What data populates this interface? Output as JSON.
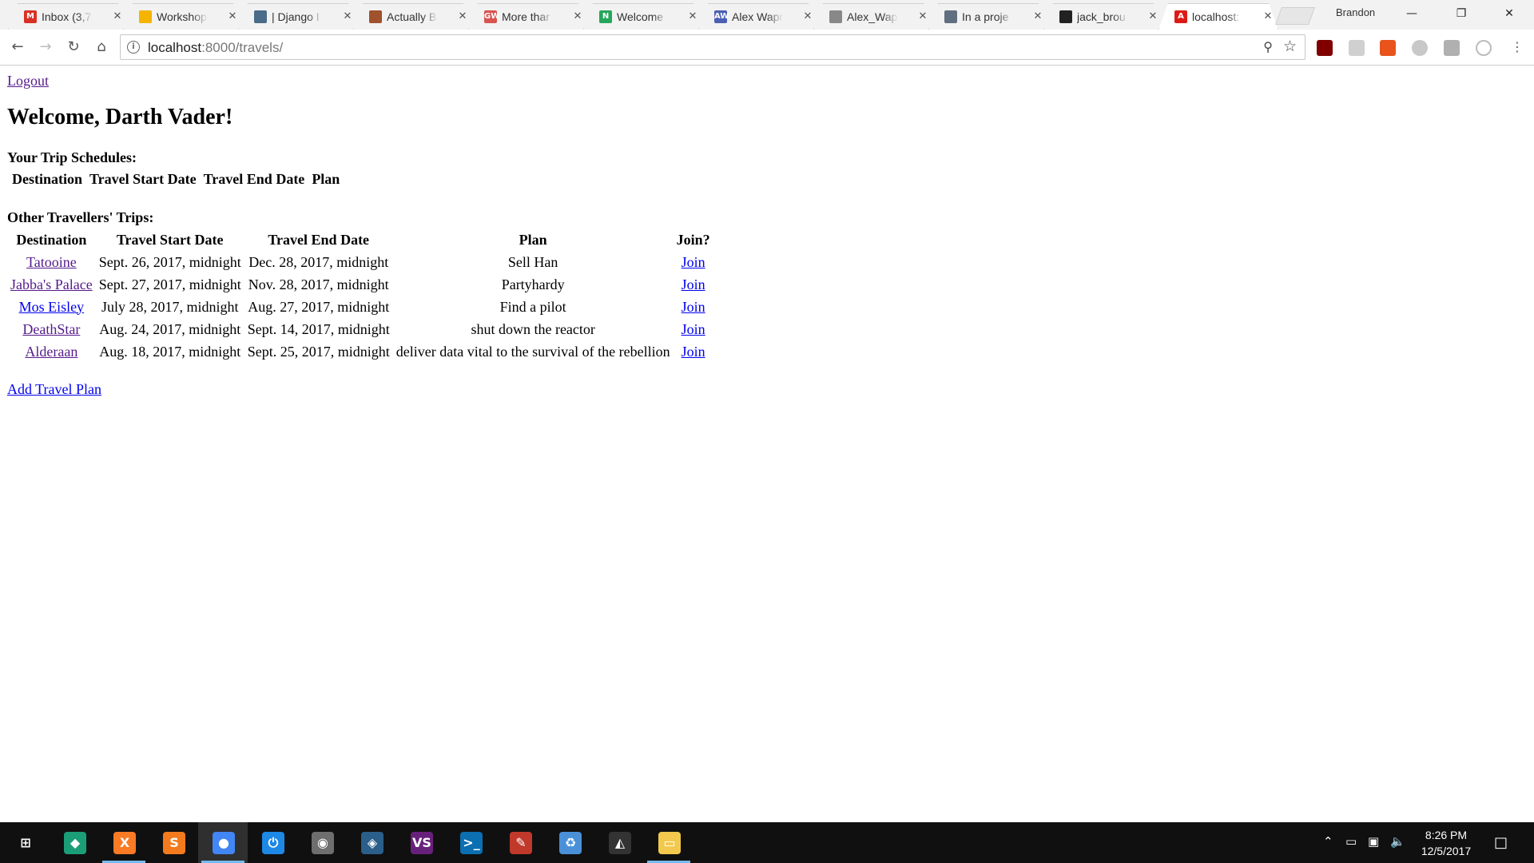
{
  "browser": {
    "tabs": [
      {
        "title": "Inbox (3,7",
        "favicon": "M",
        "color": "#d93025"
      },
      {
        "title": "Workshop",
        "favicon": "",
        "color": "#f4b400"
      },
      {
        "title": "| Django I",
        "favicon": "",
        "color": "#4a6b8a"
      },
      {
        "title": "Actually B",
        "favicon": "",
        "color": "#a0522d"
      },
      {
        "title": "More thar",
        "favicon": "GW",
        "color": "#d9534f"
      },
      {
        "title": "Welcome",
        "favicon": "N",
        "color": "#26a65b"
      },
      {
        "title": "Alex Wapr",
        "favicon": "AW",
        "color": "#4b5fb4"
      },
      {
        "title": "Alex_Wap",
        "favicon": "",
        "color": "#888888"
      },
      {
        "title": "In a proje",
        "favicon": "",
        "color": "#5f6f80"
      },
      {
        "title": "jack_brou",
        "favicon": "",
        "color": "#222222"
      },
      {
        "title": "localhost:",
        "favicon": "A",
        "color": "#dd1b16"
      }
    ],
    "active_tab": 10,
    "profile_name": "Brandon",
    "url_host": "localhost",
    "url_rest": ":8000/travels/"
  },
  "page": {
    "logout_label": "Logout",
    "welcome": "Welcome, Darth Vader!",
    "my_trips_heading": "Your Trip Schedules:",
    "my_trips_columns": [
      "Destination",
      "Travel Start Date",
      "Travel End Date",
      "Plan"
    ],
    "other_trips_heading": "Other Travellers' Trips:",
    "other_trips_columns": [
      "Destination",
      "Travel Start Date",
      "Travel End Date",
      "Plan",
      "Join?"
    ],
    "other_trips": [
      {
        "destination": "Tatooine",
        "start": "Sept. 26, 2017, midnight",
        "end": "Dec. 28, 2017, midnight",
        "plan": "Sell Han",
        "join": "Join",
        "visited": true
      },
      {
        "destination": "Jabba's Palace",
        "start": "Sept. 27, 2017, midnight",
        "end": "Nov. 28, 2017, midnight",
        "plan": "Partyhardy",
        "join": "Join",
        "visited": true
      },
      {
        "destination": "Mos Eisley",
        "start": "July 28, 2017, midnight",
        "end": "Aug. 27, 2017, midnight",
        "plan": "Find a pilot",
        "join": "Join",
        "visited": false
      },
      {
        "destination": "DeathStar",
        "start": "Aug. 24, 2017, midnight",
        "end": "Sept. 14, 2017, midnight",
        "plan": "shut down the reactor",
        "join": "Join",
        "visited": true
      },
      {
        "destination": "Alderaan",
        "start": "Aug. 18, 2017, midnight",
        "end": "Sept. 25, 2017, midnight",
        "plan": "deliver data vital to the survival of the rebellion",
        "join": "Join",
        "visited": true
      }
    ],
    "add_plan_label": "Add Travel Plan"
  },
  "taskbar": {
    "apps": [
      {
        "name": "start-button",
        "glyph": "⊞",
        "color": "#101010"
      },
      {
        "name": "gitkraken-app",
        "glyph": "◆",
        "color": "#1b9e77"
      },
      {
        "name": "xampp-app",
        "glyph": "X",
        "color": "#fb7a24"
      },
      {
        "name": "sublime-text-app",
        "glyph": "S",
        "color": "#f37b1d"
      },
      {
        "name": "chrome-app",
        "glyph": "●",
        "color": "#4285f4"
      },
      {
        "name": "power-app",
        "glyph": "⏻",
        "color": "#1e88e5"
      },
      {
        "name": "github-desktop-app",
        "glyph": "◉",
        "color": "#6e6e6e"
      },
      {
        "name": "mysql-workbench-app",
        "glyph": "◈",
        "color": "#2a5f8a"
      },
      {
        "name": "visual-studio-app",
        "glyph": "VS",
        "color": "#68217a"
      },
      {
        "name": "powershell-app",
        "glyph": ">_",
        "color": "#0b6fb1"
      },
      {
        "name": "paint-app",
        "glyph": "✎",
        "color": "#c0392b"
      },
      {
        "name": "recycle-bin-app",
        "glyph": "♻",
        "color": "#4a90d9"
      },
      {
        "name": "unity-app",
        "glyph": "◭",
        "color": "#333333"
      },
      {
        "name": "file-explorer-app",
        "glyph": "▭",
        "color": "#f2c94c"
      }
    ],
    "time": "8:26 PM",
    "date": "12/5/2017"
  }
}
